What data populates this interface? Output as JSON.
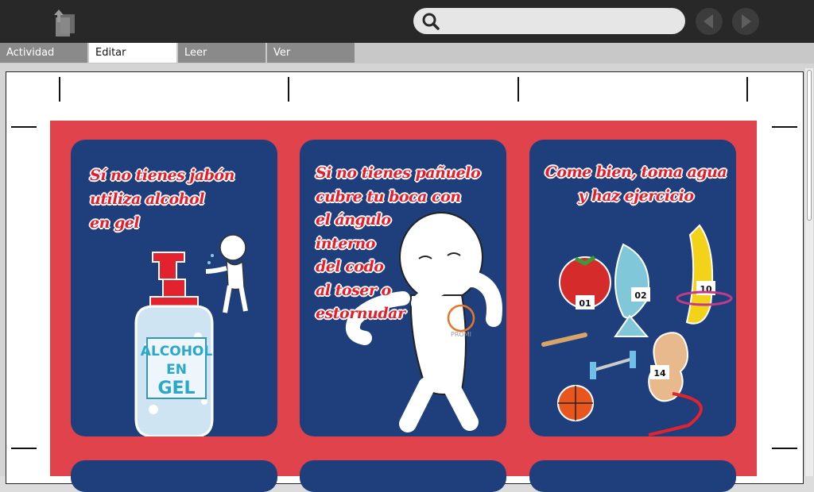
{
  "toolbar": {
    "share_icon": "activity-share-icon",
    "search": {
      "value": "",
      "placeholder": "",
      "icon": "search-icon"
    },
    "back_icon": "back-arrow-icon",
    "forward_icon": "forward-arrow-icon"
  },
  "tabs": [
    {
      "label": "Actividad",
      "active": false
    },
    {
      "label": "Editar",
      "active": true
    },
    {
      "label": "Leer",
      "active": false
    },
    {
      "label": "Ver",
      "active": false
    }
  ],
  "poster": {
    "background_color": "#e0434b",
    "card_color": "#1e3f7c",
    "cards": [
      {
        "lines": [
          "Sí no tienes jabón",
          "utiliza alcohol",
          "en gel"
        ],
        "bottle_label": [
          "ALCOHOL",
          "EN",
          "GEL"
        ]
      },
      {
        "lines": [
          "Si no tienes pañuelo",
          "cubre tu boca con",
          "el ángulo",
          "interno",
          "del codo",
          "al toser o",
          "estornudar"
        ],
        "badge": "PROMI"
      },
      {
        "lines": [
          "Come bien, toma agua",
          "y haz ejercicio"
        ],
        "bibs": [
          "01",
          "02",
          "10",
          "14"
        ]
      }
    ]
  }
}
